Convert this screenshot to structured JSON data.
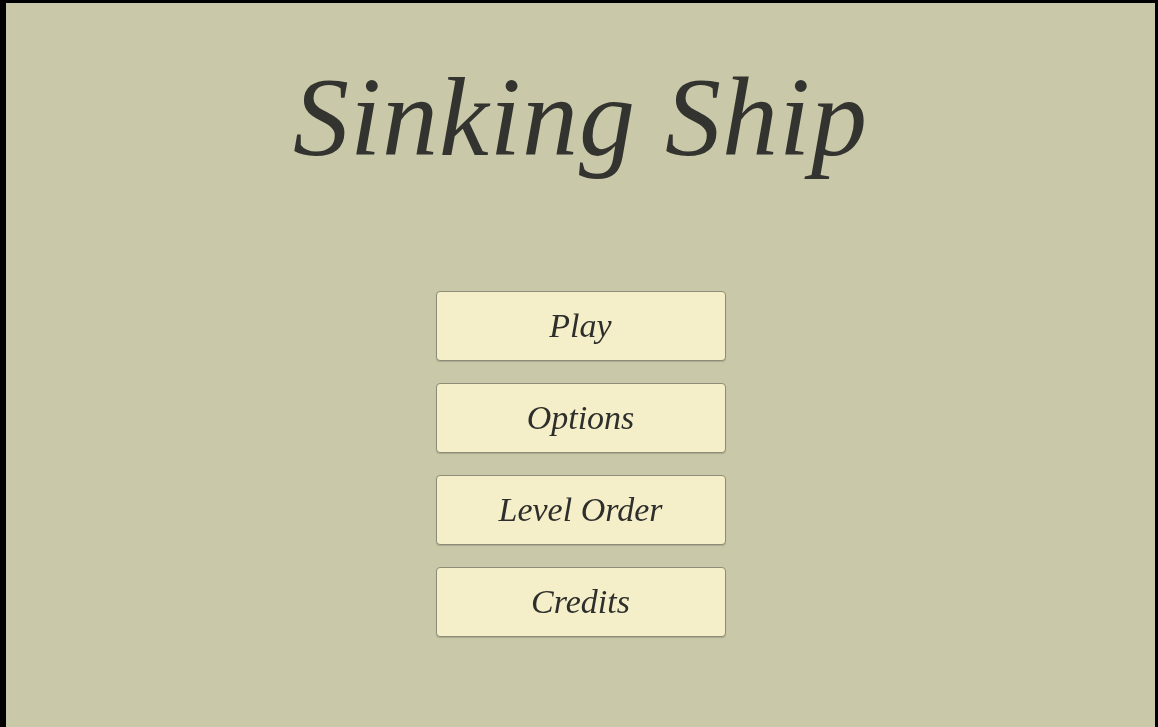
{
  "title": "Sinking Ship",
  "menu": [
    {
      "label": "Play"
    },
    {
      "label": "Options"
    },
    {
      "label": "Level Order"
    },
    {
      "label": "Credits"
    }
  ]
}
